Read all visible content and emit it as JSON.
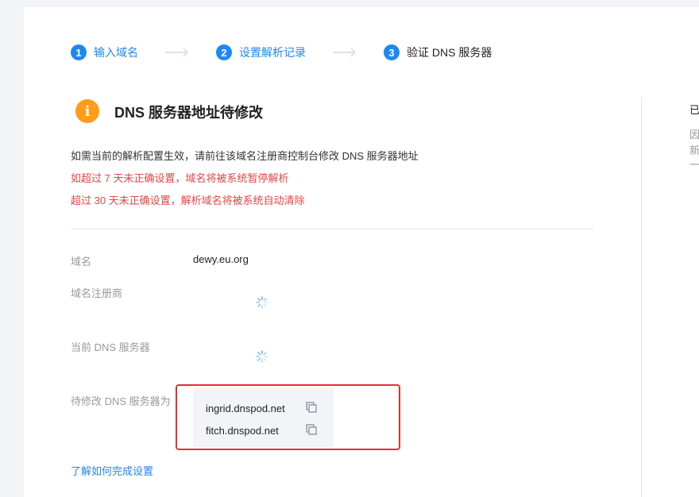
{
  "steps": [
    {
      "num": "1",
      "label": "输入域名"
    },
    {
      "num": "2",
      "label": "设置解析记录"
    },
    {
      "num": "3",
      "label": "验证 DNS 服务器"
    }
  ],
  "notice": {
    "title": "DNS 服务器地址待修改",
    "description": "如需当前的解析配置生效，请前往该域名注册商控制台修改 DNS 服务器地址",
    "warning_1": "如超过 7 天未正确设置，域名将被系统暂停解析",
    "warning_2": "超过 30 天未正确设置，解析域名将被系统自动清除"
  },
  "details": {
    "domain_label": "域名",
    "domain_value": "dewy.eu.org",
    "registrar_label": "域名注册商",
    "current_dns_label": "当前 DNS 服务器",
    "target_dns_label": "待修改 DNS 服务器为",
    "nameservers": [
      "ingrid.dnspod.net",
      "fitch.dnspod.net"
    ]
  },
  "help_link": "了解如何完成设置",
  "side_panel": {
    "line_1": "已",
    "line_2": "因",
    "line_3": "新",
    "line_4": "一"
  },
  "colors": {
    "accent": "#1e88f2",
    "warning": "#ff9c19",
    "error": "#e54545",
    "highlight": "#e5312f"
  }
}
